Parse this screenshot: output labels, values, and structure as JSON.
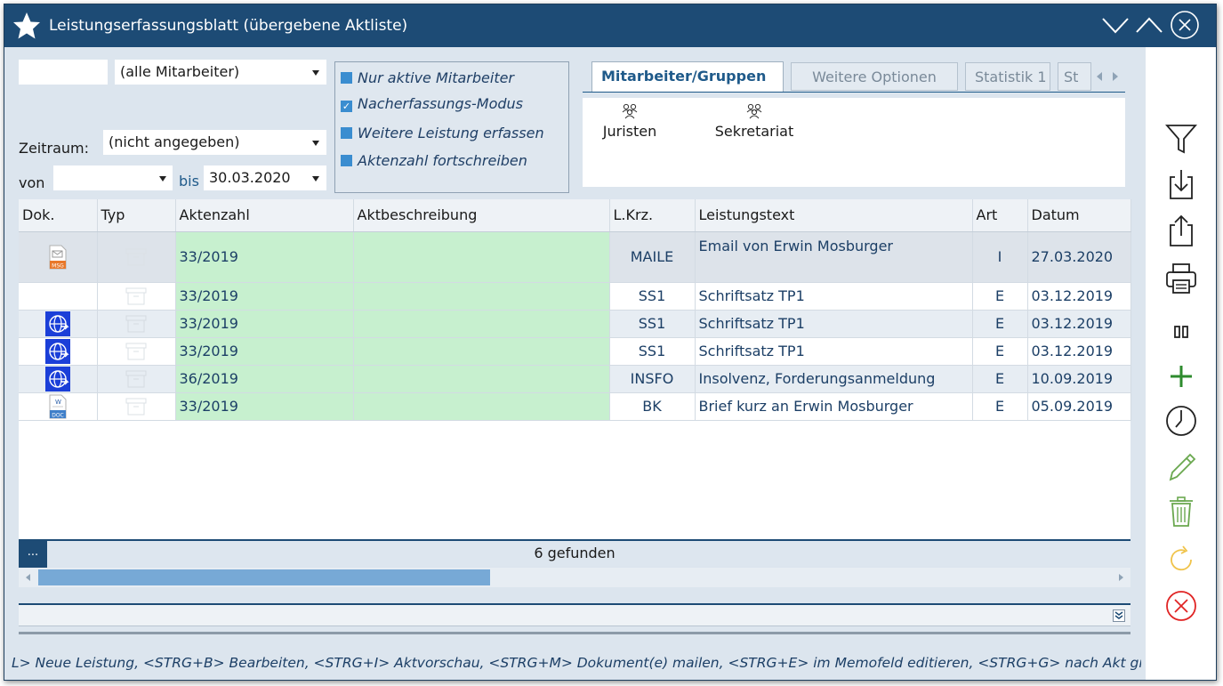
{
  "window": {
    "title": "Leistungserfassungsblatt (übergebene Aktliste)",
    "accent": "#1d4b75"
  },
  "filters": {
    "code_input": "",
    "employee_select": "(alle Mitarbeiter)",
    "period_label": "Zeitraum:",
    "period_select": "(nicht angegeben)",
    "from_label": "von",
    "from_value": "",
    "to_label": "bis",
    "to_value": "30.03.2020"
  },
  "options": [
    {
      "label": "Nur aktive Mitarbeiter",
      "checked": false
    },
    {
      "label": "Nacherfassungs-Modus",
      "checked": true
    },
    {
      "label": "Weitere Leistung erfassen",
      "checked": false
    },
    {
      "label": "Aktenzahl fortschreiben",
      "checked": false
    }
  ],
  "tabs": [
    "Mitarbeiter/Gruppen",
    "Weitere Optionen",
    "Statistik 1",
    "St"
  ],
  "groups": [
    "Juristen",
    "Sekretariat"
  ],
  "table": {
    "headers": [
      "Dok.",
      "Typ",
      "Aktenzahl",
      "Aktbeschreibung",
      "L.Krz.",
      "Leistungstext",
      "Art",
      "Datum"
    ],
    "rows": [
      {
        "doc": "msg",
        "aktenzahl": "33/2019",
        "aktbeschreibung": "",
        "lkrz": "MAILE",
        "leistungstext": "Email von Erwin Mosburger",
        "art": "I",
        "datum": "27.03.2020"
      },
      {
        "doc": "",
        "aktenzahl": "33/2019",
        "aktbeschreibung": "",
        "lkrz": "SS1",
        "leistungstext": "Schriftsatz TP1",
        "art": "E",
        "datum": "03.12.2019"
      },
      {
        "doc": "web",
        "aktenzahl": "33/2019",
        "aktbeschreibung": "",
        "lkrz": "SS1",
        "leistungstext": "Schriftsatz TP1",
        "art": "E",
        "datum": "03.12.2019"
      },
      {
        "doc": "web",
        "aktenzahl": "33/2019",
        "aktbeschreibung": "",
        "lkrz": "SS1",
        "leistungstext": "Schriftsatz TP1",
        "art": "E",
        "datum": "03.12.2019"
      },
      {
        "doc": "web",
        "aktenzahl": "36/2019",
        "aktbeschreibung": "",
        "lkrz": "INSFO",
        "leistungstext": "Insolvenz, Forderungsanmeldung",
        "art": "E",
        "datum": "10.09.2019"
      },
      {
        "doc": "doc",
        "aktenzahl": "33/2019",
        "aktbeschreibung": "",
        "lkrz": "BK",
        "leistungstext": "Brief kurz an Erwin Mosburger",
        "art": "E",
        "datum": "05.09.2019"
      }
    ]
  },
  "status": {
    "dots": "...",
    "found": "6 gefunden"
  },
  "hint": "L> Neue Leistung, <STRG+B> Bearbeiten, <STRG+I> Aktvorschau, <STRG+M> Dokument(e) mailen, <STRG+E> im Memofeld editieren, <STRG+G> nach Akt gru",
  "toolbar": [
    "filter-icon",
    "import-icon",
    "export-icon",
    "print-icon",
    "columns-icon",
    "add-icon",
    "clock-icon",
    "edit-icon",
    "delete-icon",
    "refresh-icon",
    "cancel-icon"
  ]
}
